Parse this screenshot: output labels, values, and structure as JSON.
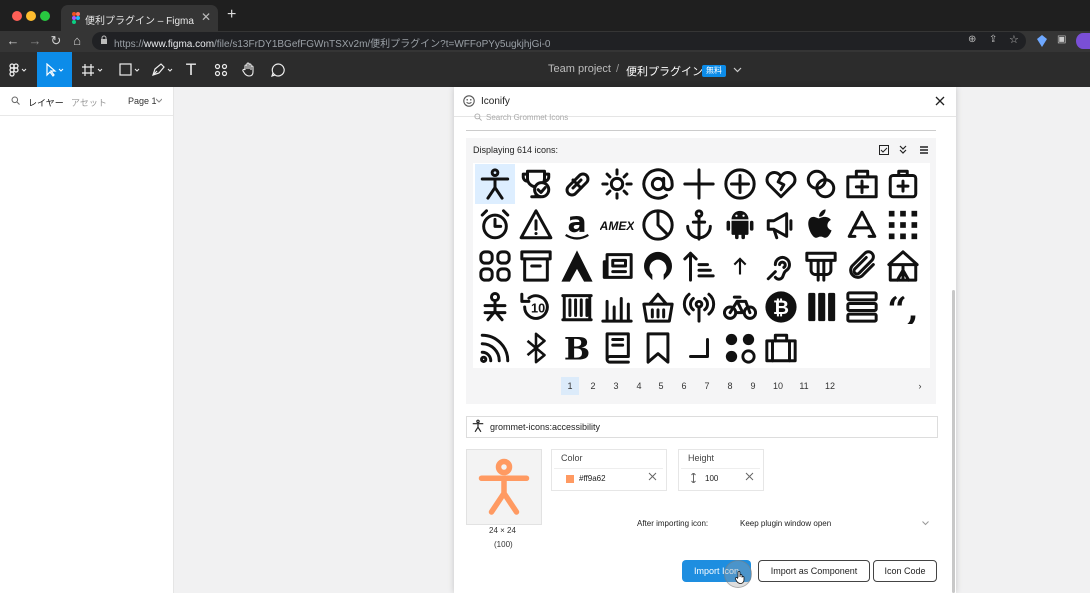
{
  "browser": {
    "tab_title": "便利プラグイン – Figma",
    "url_prefix": "https://",
    "url_host": "www.figma.com",
    "url_path": "/file/s13FrDY1BGefFGWnTSXv2m/便利プラグイン?t=WFFoPYy5ugkjhjGi-0"
  },
  "figma": {
    "team": "Team project",
    "separator": "/",
    "file": "便利プラグイン",
    "badge": "無料",
    "left_tabs": [
      "レイヤー",
      "アセット"
    ],
    "page": "Page 1"
  },
  "plugin": {
    "title": "Iconify",
    "search_placeholder": "Search Grommet Icons",
    "displaying": "Displaying 614 icons:",
    "icons": [
      "accessibility",
      "achievement",
      "aid-option",
      "announce-sun",
      "at-sign",
      "add",
      "add-circle",
      "heart-broken",
      "intersect",
      "aid",
      "firstaid",
      "alarm",
      "alert",
      "amazon",
      "amex",
      "analytics",
      "anchor",
      "android",
      "announce",
      "apple",
      "app-store",
      "apps",
      "apps-rounded",
      "archive",
      "arch",
      "article",
      "aurora",
      "ascend",
      "up-arrow",
      "assistive-listening",
      "atm",
      "attachment",
      "attraction",
      "baby",
      "backup",
      "bank",
      "bar-chart",
      "basket",
      "beacon",
      "bike",
      "bitcoin",
      "bottom-corner",
      "bookmark-lines",
      "blockquote",
      "blog",
      "bluetooth",
      "bold",
      "book",
      "bookmark",
      "corner-bottom-right",
      "bowling",
      "briefcase"
    ],
    "selected_icon": "accessibility",
    "pages": [
      "1",
      "2",
      "3",
      "4",
      "5",
      "6",
      "7",
      "8",
      "9",
      "10",
      "11",
      "12"
    ],
    "current_page": "1",
    "next": "›",
    "selected_name": "grommet-icons:accessibility",
    "preview_size": "24 × 24",
    "preview_scale": "(100)",
    "color_label": "Color",
    "color_value": "#ff9a62",
    "color_hex": "#ff9a62",
    "height_label": "Height",
    "height_value": "100",
    "after_label": "After importing icon:",
    "after_value": "Keep plugin window open",
    "buttons": {
      "import_icon": "Import Icon",
      "import_component": "Import as Component",
      "icon_code": "Icon Code"
    }
  }
}
